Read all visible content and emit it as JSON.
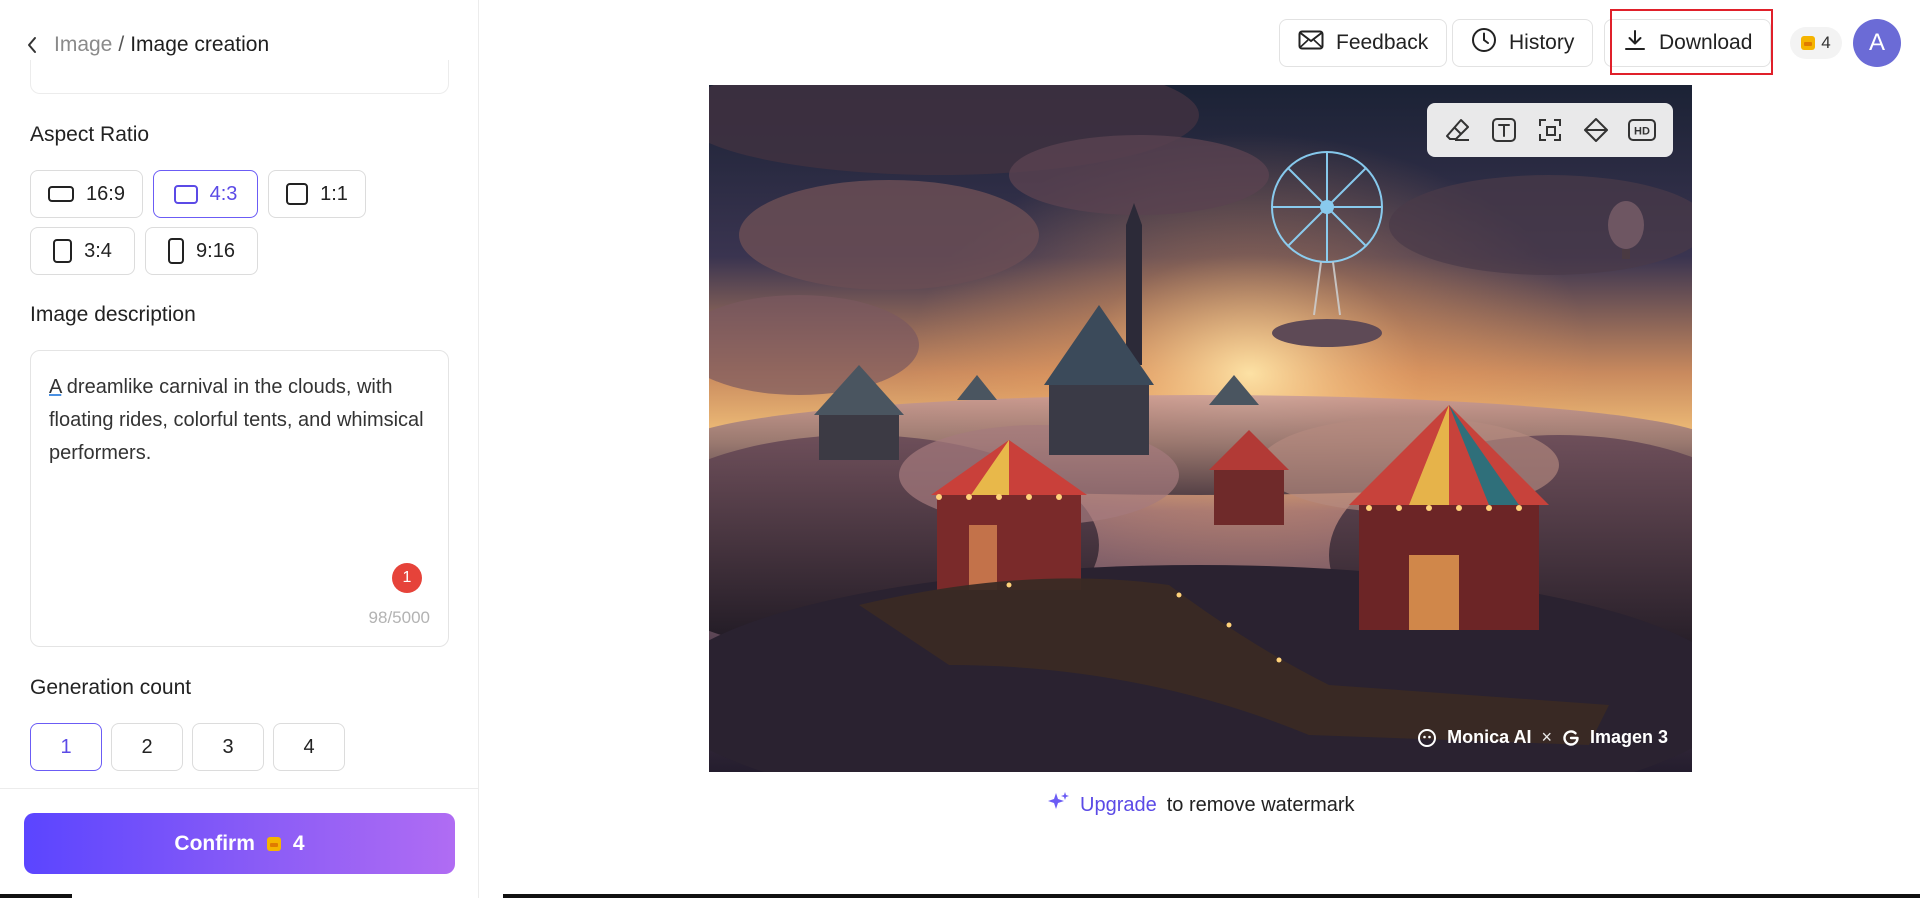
{
  "breadcrumb": {
    "parent": "Image",
    "separator": "/",
    "current": "Image creation"
  },
  "aspect_ratio": {
    "title": "Aspect Ratio",
    "options": [
      "16:9",
      "4:3",
      "1:1",
      "3:4",
      "9:16"
    ],
    "selected": "4:3"
  },
  "description": {
    "title": "Image description",
    "underlined_first_word": "A",
    "text_rest": " dreamlike carnival in the clouds, with floating rides, colorful tents, and whimsical performers.",
    "issue_count": "1",
    "char_count": "98/5000"
  },
  "generation": {
    "title": "Generation count",
    "options": [
      "1",
      "2",
      "3",
      "4"
    ],
    "selected": "1"
  },
  "confirm": {
    "label": "Confirm",
    "cost": "4"
  },
  "topbar": {
    "feedback": "Feedback",
    "history": "History",
    "download": "Download",
    "credits": "4",
    "avatar_initial": "A"
  },
  "image": {
    "tools": [
      "eraser-icon",
      "text-icon",
      "crop-icon",
      "erase-fill-icon",
      "hd-icon"
    ],
    "hd_label": "HD",
    "watermark_brand": "Monica AI",
    "watermark_x": "×",
    "watermark_model": "Imagen 3"
  },
  "upgrade": {
    "link": "Upgrade",
    "text": "to remove watermark"
  },
  "colors": {
    "accent": "#5b4ae6",
    "highlight": "#e0202a",
    "badge": "#e6433a"
  }
}
